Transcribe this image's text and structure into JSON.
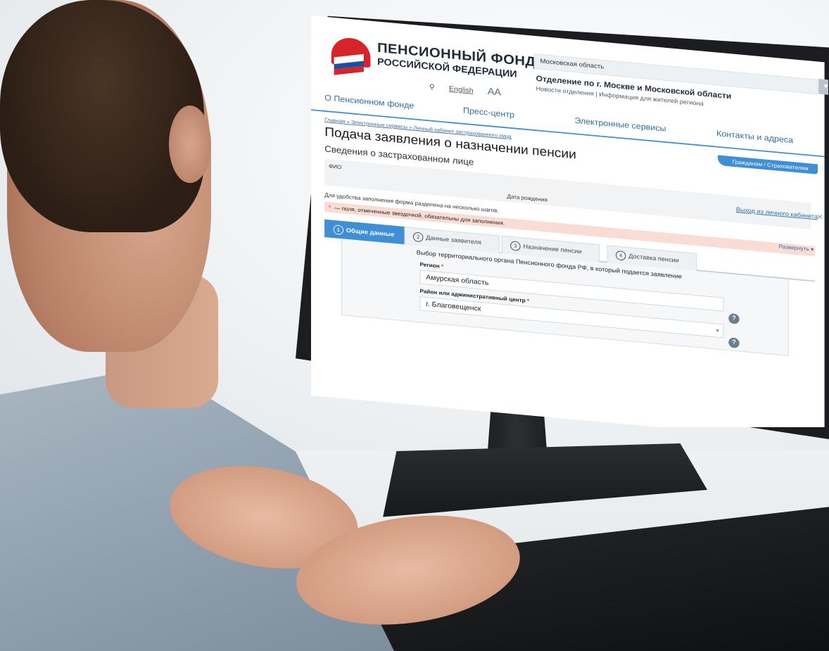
{
  "site": {
    "brand_line1": "ПЕНСИОННЫЙ ФОНД",
    "brand_line2": "РОССИЙСКОЙ ФЕДЕРАЦИИ",
    "english_link": "English",
    "font_size_toggle": "AA",
    "region_selected": "Московская область",
    "department_title": "Отделение по г. Москве и Московской области",
    "department_links": "Новости отделения  |  Информация для жителей региона",
    "nav": {
      "about": "О Пенсионном фонде",
      "press": "Пресс-центр",
      "services": "Электронные сервисы",
      "contacts": "Контакты и адреса"
    },
    "breadcrumb": "Главная » Электронные сервисы » Личный кабинет застрахованного лица",
    "audience_pill": "Гражданам / Страхователям",
    "page_title": "Подача заявления о назначении пенсии",
    "section_title": "Сведения о застрахованном лице",
    "info": {
      "fio_label": "ФИО",
      "dob_label": "Дата рождения"
    },
    "logout_link": "Выход из личного кабинета",
    "steps_note": "Для удобства заполнения форма разделена на несколько шагов.",
    "expand_link": "Развернуть",
    "required_note": "— поля, отмеченные звездочкой, обязательны для заполнения.",
    "tabs": [
      {
        "num": "1",
        "label": "Общие данные"
      },
      {
        "num": "2",
        "label": "Данные заявителя"
      },
      {
        "num": "3",
        "label": "Назначение пенсии"
      },
      {
        "num": "4",
        "label": "Доставка пенсии"
      }
    ],
    "form": {
      "legend": "Выбор территориального органа Пенсионного фонда РФ, в который подается заявление",
      "region_label": "Регион",
      "region_value": "Амурская область",
      "district_label": "Район или административный центр",
      "district_value": "г. Благовещенск"
    }
  },
  "colors": {
    "brand_red": "#d7242b",
    "accent_blue": "#3f8fd6",
    "warning_bg": "#f9dcd3"
  },
  "icons": [
    "search-icon",
    "help-icon",
    "close-icon",
    "chevron-down-icon"
  ]
}
